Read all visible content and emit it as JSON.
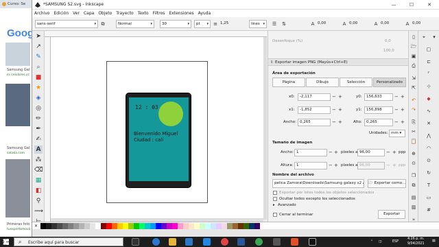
{
  "browser": {
    "tab_title": "Curso: Se",
    "search_logo": "Goog",
    "results": [
      {
        "title": "Samsung Gal",
        "sub": "cs celulares.cc"
      },
      {
        "title": "Samsung Gal",
        "sub": "sataka.com"
      },
      {
        "title": "Primeras foto",
        "sub": "tuexpertomovil"
      }
    ]
  },
  "window": {
    "title": "*SAMSUNG S2.svg - Inkscape",
    "minimize": "—",
    "maximize": "☐",
    "close": "✕"
  },
  "menu": [
    "Archivo",
    "Edición",
    "Ver",
    "Capa",
    "Objeto",
    "Trayecto",
    "Texto",
    "Filtros",
    "Extensiones",
    "Ayuda"
  ],
  "text_toolbar": {
    "font_family": "sans-serif",
    "font_style": "Normal",
    "font_size": "30",
    "unit": "pt",
    "line_spacing": "1,25",
    "spacing_unit": "lines",
    "letter_spacing": "0,00",
    "word_spacing": "0,00",
    "kerning": "0,00",
    "shift": "0,00"
  },
  "drawing": {
    "clock_text": "12 : 03",
    "body_text": "Bienvenido Miguel  Ciudad : cali"
  },
  "export_panel": {
    "blur_label": "Desenfoque (%)",
    "blur_value": "0,0",
    "opacity_value": "100,0",
    "tab_label": "Exportar imagen PNG (Mayús+Ctrl+E)",
    "area_heading": "Área de exportación",
    "area_buttons": [
      {
        "label": "Página",
        "selected": false
      },
      {
        "label": "Dibujo",
        "selected": false
      },
      {
        "label": "Selección",
        "selected": false
      },
      {
        "label": "Personalizado",
        "selected": true
      }
    ],
    "x0_label": "x0:",
    "x0": "-2,117",
    "x1_label": "x1:",
    "x1": "-1,852",
    "width_label": "Ancho:",
    "width": "0,265",
    "y0_label": "y0:",
    "y0": "156,633",
    "y1_label": "y1:",
    "y1": "156,898",
    "height_label": "Alto:",
    "height": "0,265",
    "units_label": "Unidades:",
    "units": "mm",
    "image_size_heading": "Tamaño de imagen",
    "img_width_label": "Ancho:",
    "img_width": "1",
    "img_height_label": "Altura:",
    "img_height": "1",
    "px_at": "píxeles a",
    "dpi": "96,00",
    "dpi_disabled": "96,00",
    "ppp": "ppp",
    "filename_heading": "Nombre del archivo",
    "filename": "pelica Zamora\\Downloads\\Samsung galaxy s2 A.png",
    "export_as_button": "Exportar como...",
    "batch_label": "Exportar por lotes todos los objetos seleccionados",
    "hide_label": "Ocultar todos excepto los seleccionados",
    "advanced_label": "Avanzado",
    "close_when_done": "Cerrar al terminar",
    "export_button": "Exportar"
  },
  "palette_colors": [
    "#000000",
    "#1a1a1a",
    "#333333",
    "#4d4d4d",
    "#666666",
    "#808080",
    "#999999",
    "#b3b3b3",
    "#cccccc",
    "#e6e6e6",
    "#ffffff",
    "#800000",
    "#ff0000",
    "#ff6600",
    "#ffcc00",
    "#ffff00",
    "#99cc00",
    "#00cc00",
    "#00ff66",
    "#00cccc",
    "#0099ff",
    "#0000ff",
    "#6600cc",
    "#cc00cc",
    "#ff00cc",
    "#ff99cc",
    "#ffcccc",
    "#ffe6cc",
    "#ffffcc",
    "#ccffcc",
    "#ccffff",
    "#cce6ff",
    "#e6ccff",
    "#f2d9e6",
    "#999966",
    "#996633",
    "#663300",
    "#336600",
    "#003366",
    "#330066"
  ],
  "taskbar": {
    "search_placeholder": "Escribe aquí para buscar",
    "time": "4:26 p. m.",
    "date": "9/04/2021",
    "lang": "ESP"
  }
}
